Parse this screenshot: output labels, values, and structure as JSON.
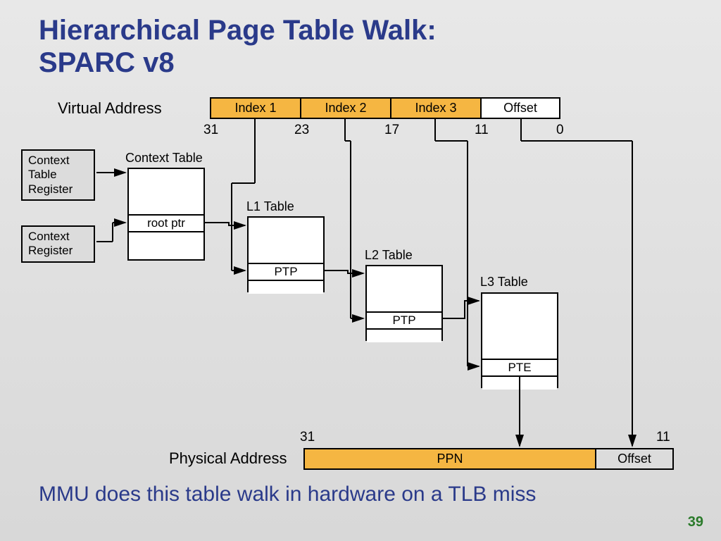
{
  "title_line1": "Hierarchical Page Table Walk:",
  "title_line2": "SPARC v8",
  "virtual_address_label": "Virtual Address",
  "physical_address_label": "Physical Address",
  "va_fields": {
    "index1": "Index 1",
    "index2": "Index 2",
    "index3": "Index 3",
    "offset": "Offset"
  },
  "va_bits": {
    "b31": "31",
    "b23": "23",
    "b17": "17",
    "b11": "11",
    "b0": "0"
  },
  "registers": {
    "ctx_table_reg": "Context\nTable\nRegister",
    "ctx_reg": "Context\nRegister"
  },
  "tables": {
    "context_table": "Context Table",
    "l1_table": "L1 Table",
    "l2_table": "L2 Table",
    "l3_table": "L3 Table",
    "root_ptr": "root ptr",
    "ptp": "PTP",
    "pte": "PTE"
  },
  "pa_fields": {
    "ppn": "PPN",
    "offset": "Offset"
  },
  "pa_bits": {
    "b31": "31",
    "b11": "11"
  },
  "footer": "MMU does this table walk in hardware on a TLB miss",
  "slide_number": "39"
}
